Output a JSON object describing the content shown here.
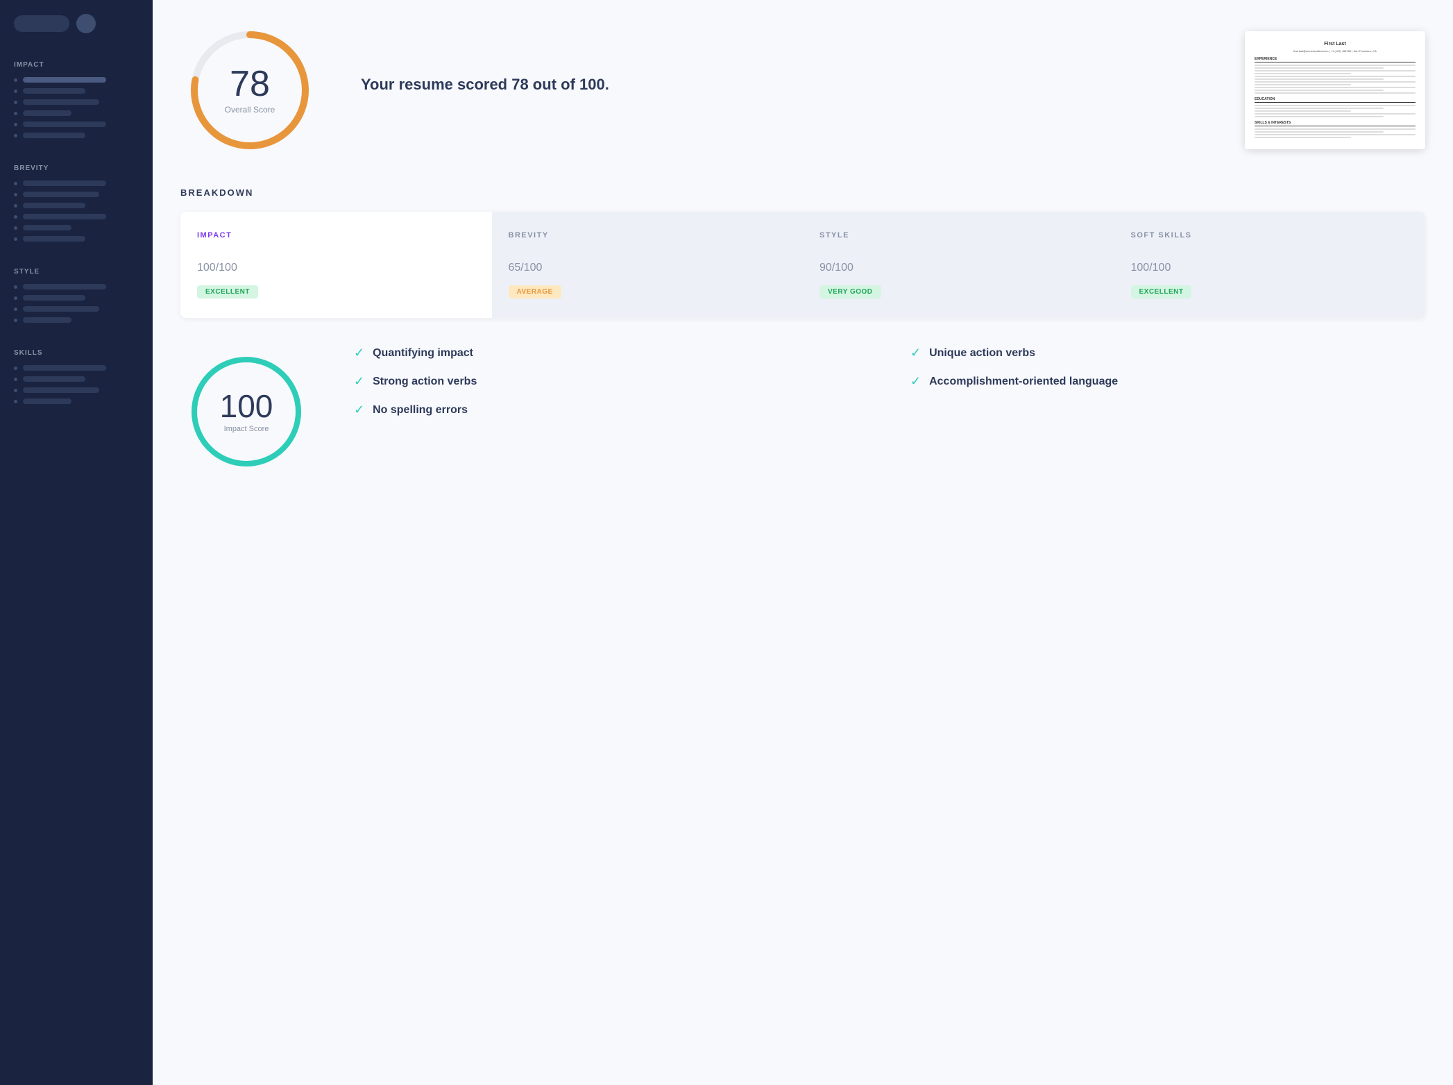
{
  "sidebar": {
    "sections": [
      {
        "title": "IMPACT",
        "items": [
          {
            "bar_width": "full"
          },
          {
            "bar_width": "med"
          },
          {
            "bar_width": "long"
          },
          {
            "bar_width": "short"
          },
          {
            "bar_width": "full"
          },
          {
            "bar_width": "med"
          }
        ]
      },
      {
        "title": "BREVITY",
        "items": [
          {
            "bar_width": "full"
          },
          {
            "bar_width": "long"
          },
          {
            "bar_width": "med"
          },
          {
            "bar_width": "full"
          },
          {
            "bar_width": "short"
          },
          {
            "bar_width": "med"
          }
        ]
      },
      {
        "title": "STYLE",
        "items": [
          {
            "bar_width": "full"
          },
          {
            "bar_width": "med"
          },
          {
            "bar_width": "long"
          },
          {
            "bar_width": "short"
          }
        ]
      },
      {
        "title": "SKILLS",
        "items": [
          {
            "bar_width": "full"
          },
          {
            "bar_width": "med"
          },
          {
            "bar_width": "long"
          },
          {
            "bar_width": "short"
          }
        ]
      }
    ]
  },
  "header": {
    "score_headline": "Your resume scored 78 out of 100.",
    "overall_score": "78",
    "overall_label": "Overall Score"
  },
  "resume_preview": {
    "name": "First Last",
    "contact": "first.last@someemailed.com | +1 (123) 456789 | San Francisco, CA"
  },
  "breakdown": {
    "title": "BREAKDOWN",
    "columns": [
      {
        "id": "impact",
        "title": "IMPACT",
        "score": "100",
        "max": "100",
        "badge": "EXCELLENT",
        "badge_type": "excellent",
        "is_first": true
      },
      {
        "id": "brevity",
        "title": "BREVITY",
        "score": "65",
        "max": "100",
        "badge": "AVERAGE",
        "badge_type": "average",
        "is_first": false
      },
      {
        "id": "style",
        "title": "STYLE",
        "score": "90",
        "max": "100",
        "badge": "VERY GOOD",
        "badge_type": "very-good",
        "is_first": false
      },
      {
        "id": "soft-skills",
        "title": "SOFT SKILLS",
        "score": "100",
        "max": "100",
        "badge": "EXCELLENT",
        "badge_type": "excellent",
        "is_first": false
      }
    ]
  },
  "impact_detail": {
    "score": "100",
    "label": "Impact Score",
    "checks": [
      {
        "text": "Quantifying impact",
        "col": 1
      },
      {
        "text": "Unique action verbs",
        "col": 2
      },
      {
        "text": "Strong action verbs",
        "col": 1
      },
      {
        "text": "Accomplishment-oriented language",
        "col": 2
      },
      {
        "text": "No spelling errors",
        "col": 1
      }
    ]
  }
}
